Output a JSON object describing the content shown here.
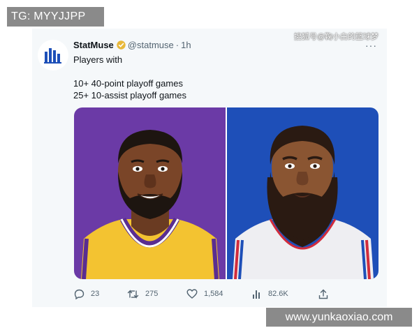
{
  "overlay": {
    "tg_label": "TG: MYYJJPP",
    "top_watermark": "搜狐号@鞠小白的篮球梦",
    "site_label": "www.yunkaoxiao.com"
  },
  "tweet": {
    "author_name": "StatMuse",
    "handle": "@statmuse",
    "separator": "·",
    "time": "1h",
    "more_label": "···",
    "text_line1": "Players with",
    "text_line2": "10+ 40-point playoff games",
    "text_line3": "25+ 10-assist playoff games",
    "verified_color": "#e8b83a",
    "accent_color": "#1d4fb8"
  },
  "actions": {
    "replies": "23",
    "retweets": "275",
    "likes": "1,584",
    "views": "82.6K"
  },
  "icons": {
    "avatar": "statmuse-logo-icon",
    "verified": "verified-badge-icon",
    "reply": "reply-icon",
    "retweet": "retweet-icon",
    "like": "heart-icon",
    "views": "views-bar-chart-icon",
    "share": "share-icon"
  }
}
